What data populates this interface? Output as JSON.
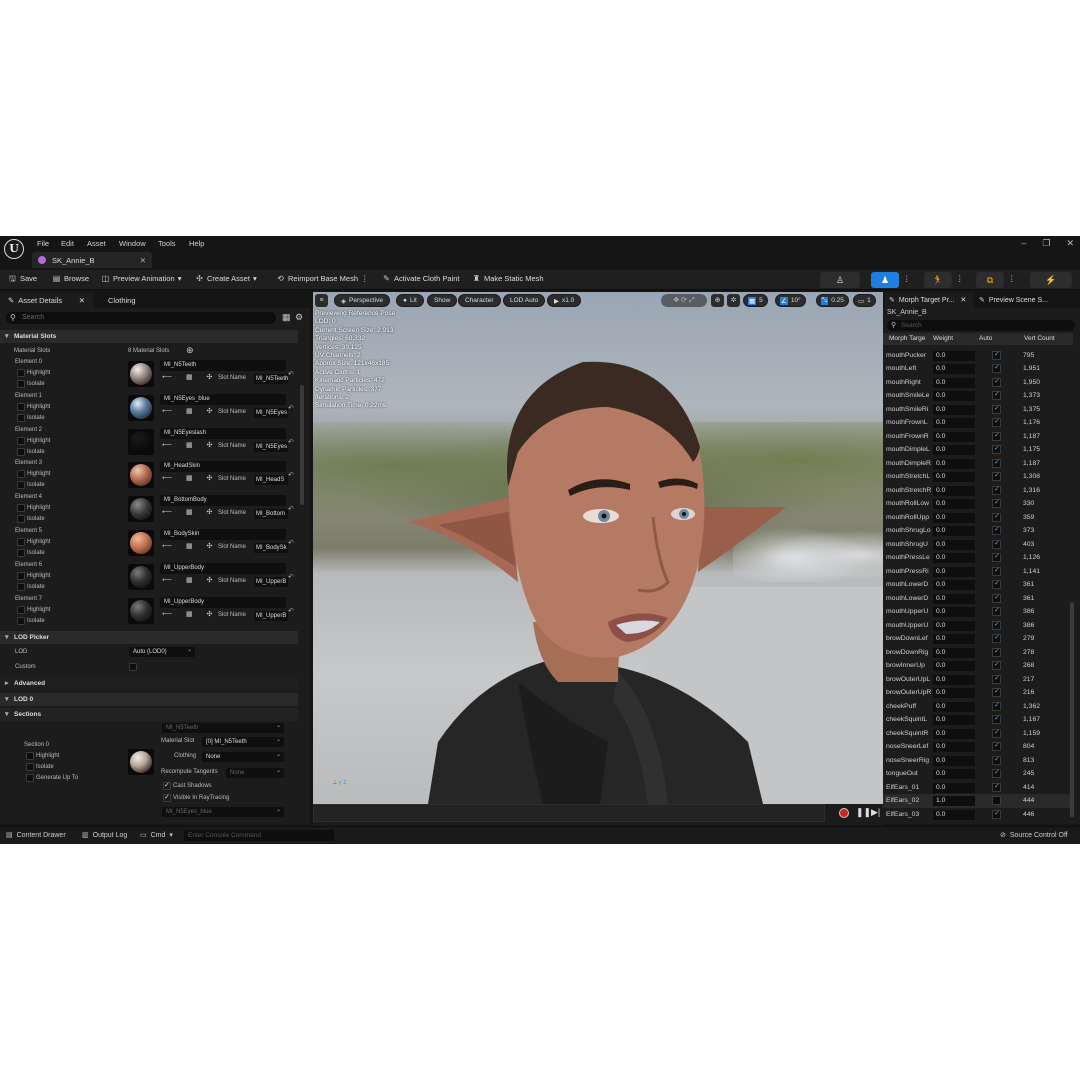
{
  "menu": {
    "items": [
      "File",
      "Edit",
      "Asset",
      "Window",
      "Tools",
      "Help"
    ]
  },
  "tab": {
    "label": "SK_Annie_B"
  },
  "toolbar": {
    "save": "Save",
    "browse": "Browse",
    "preview_animation": "Preview Animation",
    "create_asset": "Create Asset",
    "reimport": "Reimport Base Mesh",
    "activate_cloth": "Activate Cloth Paint",
    "make_static": "Make Static Mesh"
  },
  "left_panel": {
    "tabs": [
      "Asset Details",
      "Clothing"
    ],
    "search_placeholder": "Search",
    "material_slots_header": "Material Slots",
    "material_slots_label": "Material Slots",
    "material_slots_count": "8 Material Slots",
    "highlight": "Highlight",
    "isolate": "Isolate",
    "slot_name_label": "Slot Name",
    "elements": [
      {
        "label": "Element 0",
        "material": "MI_N5Teeth",
        "slot": "MI_N5Teeth"
      },
      {
        "label": "Element 1",
        "material": "MI_N5Eyes_blue",
        "slot": "MI_N5Eyes"
      },
      {
        "label": "Element 2",
        "material": "MI_N5Eyeslash",
        "slot": "MI_N5Eyes"
      },
      {
        "label": "Element 3",
        "material": "MI_HeadSkin",
        "slot": "MI_HeadS"
      },
      {
        "label": "Element 4",
        "material": "MI_BottomBody",
        "slot": "MI_Bottom"
      },
      {
        "label": "Element 5",
        "material": "MI_BodySkin",
        "slot": "MI_BodySk"
      },
      {
        "label": "Element 6",
        "material": "MI_UpperBody",
        "slot": "MI_UpperB"
      },
      {
        "label": "Element 7",
        "material": "MI_UpperBody",
        "slot": "MI_UpperB"
      }
    ],
    "lod_picker_header": "LOD Picker",
    "lod_label": "LOD",
    "lod_value": "Auto (LOD0)",
    "custom_label": "Custom",
    "advanced_header": "Advanced",
    "lod0_header": "LOD 0",
    "sections_header": "Sections",
    "section0": {
      "label": "Section 0",
      "highlight": "Highlight",
      "isolate": "Isolate",
      "generate": "Generate Up To",
      "top_dropdown": "MI_N5Teeth",
      "material_slot_label": "Material Slot",
      "material_slot_value": "[0] MI_N5Teeth",
      "clothing_label": "Clothing",
      "clothing_value": "None",
      "recompute_label": "Recompute Tangents",
      "recompute_value": "None",
      "cast_shadows": "Cast Shadows",
      "visible_rt": "Visible In RayTracing",
      "next_dropdown": "MI_N5Eyes_blue"
    }
  },
  "viewport": {
    "perspective": "Perspective",
    "lit": "Lit",
    "show": "Show",
    "character": "Character",
    "lod": "LOD Auto",
    "speed": "x1.0",
    "grid_value": "5",
    "angle_value": "10°",
    "scale_value": "0.25",
    "cam_value": "1",
    "stats": [
      "Previewing Reference Pose",
      "LOD: 0",
      "Current Screen Size: 2.913",
      "Triangles: 60,332",
      "Vertices: 39,125",
      "UV Channels: 2",
      "Approx Size: 121x46x185",
      "Active Cloths: 1",
      "Kinematic Particles: 472",
      "Dynamic Particles: 377",
      "Iterations: 2",
      "Simulation Time: 0.22ms"
    ]
  },
  "right_panel": {
    "tabs": [
      "Morph Target Pr...",
      "Preview Scene S..."
    ],
    "asset_name": "SK_Annie_B",
    "search_placeholder": "Search",
    "columns": [
      "Morph Targe",
      "Weight",
      "Auto",
      "Vert Count"
    ],
    "rows": [
      {
        "name": "mouthPucker",
        "weight": "0.0",
        "auto": true,
        "count": "795"
      },
      {
        "name": "mouthLeft",
        "weight": "0.0",
        "auto": true,
        "count": "1,951"
      },
      {
        "name": "mouthRight",
        "weight": "0.0",
        "auto": true,
        "count": "1,950"
      },
      {
        "name": "mouthSmileLe",
        "weight": "0.0",
        "auto": true,
        "count": "1,373"
      },
      {
        "name": "mouthSmileRi",
        "weight": "0.0",
        "auto": true,
        "count": "1,375"
      },
      {
        "name": "mouthFrownL",
        "weight": "0.0",
        "auto": true,
        "count": "1,176"
      },
      {
        "name": "mouthFrownR",
        "weight": "0.0",
        "auto": true,
        "count": "1,187"
      },
      {
        "name": "mouthDimpleL",
        "weight": "0.0",
        "auto": true,
        "count": "1,175"
      },
      {
        "name": "mouthDimpleR",
        "weight": "0.0",
        "auto": true,
        "count": "1,187"
      },
      {
        "name": "mouthStretchL",
        "weight": "0.0",
        "auto": true,
        "count": "1,308"
      },
      {
        "name": "mouthStretchR",
        "weight": "0.0",
        "auto": true,
        "count": "1,316"
      },
      {
        "name": "mouthRollLow",
        "weight": "0.0",
        "auto": true,
        "count": "330"
      },
      {
        "name": "mouthRollUpp",
        "weight": "0.0",
        "auto": true,
        "count": "359"
      },
      {
        "name": "mouthShrugLo",
        "weight": "0.0",
        "auto": true,
        "count": "373"
      },
      {
        "name": "mouthShrugU",
        "weight": "0.0",
        "auto": true,
        "count": "403"
      },
      {
        "name": "mouthPressLe",
        "weight": "0.0",
        "auto": true,
        "count": "1,126"
      },
      {
        "name": "mouthPressRi",
        "weight": "0.0",
        "auto": true,
        "count": "1,141"
      },
      {
        "name": "mouthLowerD",
        "weight": "0.0",
        "auto": true,
        "count": "361"
      },
      {
        "name": "mouthLowerD",
        "weight": "0.0",
        "auto": true,
        "count": "361"
      },
      {
        "name": "mouthUpperU",
        "weight": "0.0",
        "auto": true,
        "count": "386"
      },
      {
        "name": "mouthUpperU",
        "weight": "0.0",
        "auto": true,
        "count": "386"
      },
      {
        "name": "browDownLef",
        "weight": "0.0",
        "auto": true,
        "count": "279"
      },
      {
        "name": "browDownRig",
        "weight": "0.0",
        "auto": true,
        "count": "278"
      },
      {
        "name": "browInnerUp",
        "weight": "0.0",
        "auto": true,
        "count": "268"
      },
      {
        "name": "browOuterUpL",
        "weight": "0.0",
        "auto": true,
        "count": "217"
      },
      {
        "name": "browOuterUpR",
        "weight": "0.0",
        "auto": true,
        "count": "216"
      },
      {
        "name": "cheekPuff",
        "weight": "0.0",
        "auto": true,
        "count": "1,362"
      },
      {
        "name": "cheekSquintL",
        "weight": "0.0",
        "auto": true,
        "count": "1,167"
      },
      {
        "name": "cheekSquintR",
        "weight": "0.0",
        "auto": true,
        "count": "1,159"
      },
      {
        "name": "noseSneerLef",
        "weight": "0.0",
        "auto": true,
        "count": "804"
      },
      {
        "name": "noseSneerRig",
        "weight": "0.0",
        "auto": true,
        "count": "813"
      },
      {
        "name": "tongueOut",
        "weight": "0.0",
        "auto": true,
        "count": "245"
      },
      {
        "name": "ElfEars_01",
        "weight": "0.0",
        "auto": true,
        "count": "414"
      },
      {
        "name": "ElfEars_02",
        "weight": "1.0",
        "auto": false,
        "count": "444"
      },
      {
        "name": "ElfEars_03",
        "weight": "0.0",
        "auto": true,
        "count": "446"
      }
    ]
  },
  "statusbar": {
    "content_drawer": "Content Drawer",
    "output_log": "Output Log",
    "cmd": "Cmd",
    "console_placeholder": "Enter Console Command",
    "source_control": "Source Control Off"
  },
  "colors": {
    "accent": "#1f7fe0",
    "background": "#151515",
    "panel": "#1c1c1c"
  }
}
